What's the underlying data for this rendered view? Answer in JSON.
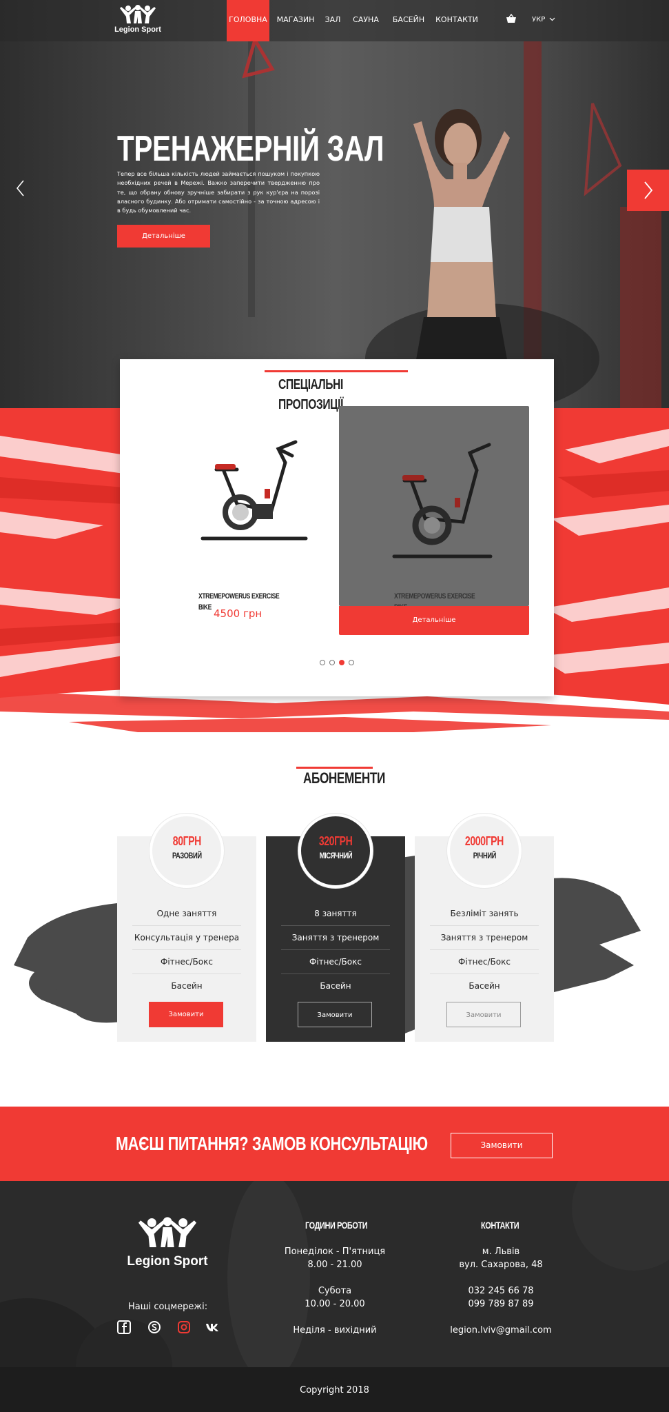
{
  "nav": {
    "logo_text": "Legion Sport",
    "items": [
      "ГОЛОВНА",
      "МАГАЗИН",
      "ЗАЛ",
      "САУНА",
      "БАСЕЙН",
      "КОНТАКТИ"
    ],
    "lang": "УКР",
    "active_index": 0
  },
  "hero": {
    "title": "ТРЕНАЖЕРНІЙ ЗАЛ",
    "text": "Тепер все більша кількість людей займається пошуком і покупкою необхідних речей в Мережі. Важко заперечити твердженню про те, що обрану обнову зручніше забирати з рук кур'єра на порозі власного будинку. Або отримати самостійно - за точною адресою і в будь обумовлений час.",
    "button": "Детальніше"
  },
  "offers": {
    "title_line1": "СПЕЦІАЛЬНІ",
    "title_line2": "ПРОПОЗИЦІЇ",
    "products": [
      {
        "name_line1": "XTREMEPOWERUS EXERCISE",
        "name_line2": "BIKE",
        "price": "4500 грн"
      },
      {
        "name_line1": "XTREMEPOWERUS EXERCISE",
        "name_line2": "BIKE",
        "button": "Детальніше"
      }
    ],
    "dots": 4,
    "active_dot": 2
  },
  "subscriptions": {
    "title": "АБОНЕМЕНТИ",
    "plans": [
      {
        "price": "80ГРН",
        "type": "РАЗОВИЙ",
        "features": [
          "Одне заняття",
          "Консультація у тренера",
          "Фітнес/Бокс",
          "Басейн"
        ],
        "button": "Замовити"
      },
      {
        "price": "320ГРН",
        "type": "МІСЯЧНИЙ",
        "features": [
          "8 заняття",
          "Заняття з тренером",
          "Фітнес/Бокс",
          "Басейн"
        ],
        "button": "Замовити"
      },
      {
        "price": "2000ГРН",
        "type": "РІЧНИЙ",
        "features": [
          "Безліміт занять",
          "Заняття з тренером",
          "Фітнес/Бокс",
          "Басейн"
        ],
        "button": "Замовити"
      }
    ]
  },
  "cta": {
    "text": "МАЄШ ПИТАННЯ? ЗАМОВ  КОНСУЛЬТАЦІЮ",
    "button": "Замовити"
  },
  "footer": {
    "logo_text": "Legion Sport",
    "social_label": "Наші соцмережі:",
    "social_icons": [
      "facebook-icon",
      "skype-icon",
      "instagram-icon",
      "vk-icon"
    ],
    "hours_title": "ГОДИНИ РОБОТИ",
    "hours": {
      "weekdays_label": "Понеділок - П'ятниця",
      "weekdays_time": "8.00 - 21.00",
      "saturday_label": "Субота",
      "saturday_time": "10.00 - 20.00",
      "sunday": "Неділя - вихідний"
    },
    "contacts_title": "КОНТАКТИ",
    "contacts": {
      "city": "м. Львів",
      "street": "вул. Сахарова, 48",
      "phone1": "032 245 66 78",
      "phone2": "099 789 87 89",
      "email": "legion.lviv@gmail.com"
    },
    "copyright": "Copyright 2018"
  },
  "colors": {
    "accent": "#f03a34",
    "dark": "#303030",
    "light_card": "#f1f1f1"
  }
}
